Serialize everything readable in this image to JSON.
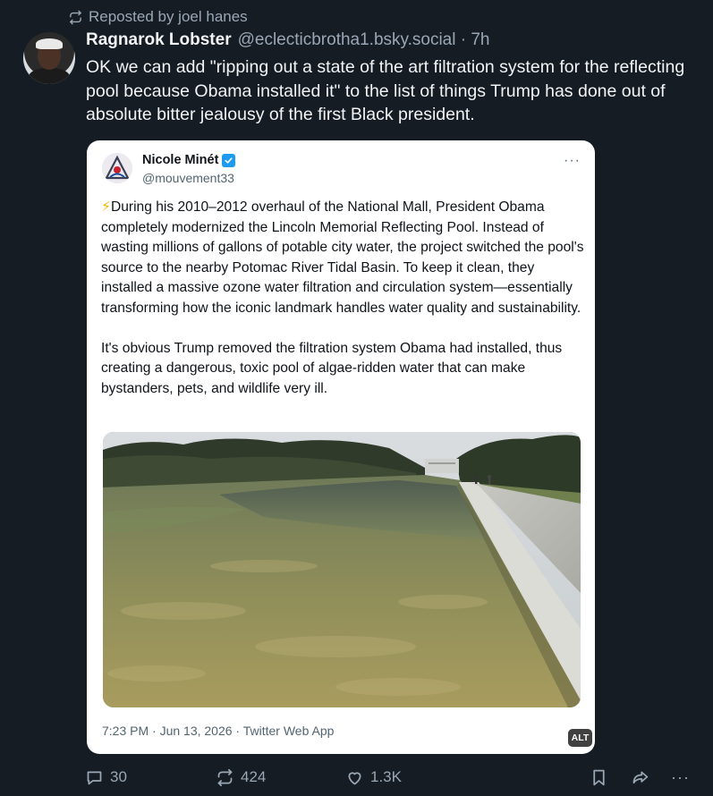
{
  "repost": {
    "icon": "repost-icon",
    "label": "Reposted by joel hanes"
  },
  "post": {
    "author_name": "Ragnarok Lobster",
    "author_handle": "@eclecticbrotha1.bsky.social · 7h",
    "text": "OK we can add \"ripping out a state of the art filtration system for the reflecting pool because Obama installed it\" to the list of things Trump has done out of absolute bitter jealousy of the first Black president."
  },
  "embed": {
    "name": "Nicole Minét",
    "handle": "@mouvement33",
    "more": "···",
    "paragraph1_emoji": "⚡",
    "paragraph1": "During his 2010–2012 overhaul of the National Mall, President Obama completely modernized the Lincoln Memorial Reflecting Pool. Instead of wasting millions of gallons of potable city water, the project switched the pool's source to the nearby Potomac River Tidal Basin. To keep it clean, they installed a massive ozone water filtration and circulation system—essentially transforming how the iconic landmark handles water quality and sustainability.",
    "paragraph2": "It's obvious Trump removed the filtration system Obama had installed, thus creating a dangerous, toxic pool of algae-ridden water that can make bystanders, pets, and wildlife very ill.",
    "meta": "7:23 PM · Jun 13, 2026 · Twitter Web App",
    "alt": "ALT"
  },
  "actions": {
    "replies": "30",
    "reposts": "424",
    "likes": "1.3K",
    "more": "···"
  }
}
